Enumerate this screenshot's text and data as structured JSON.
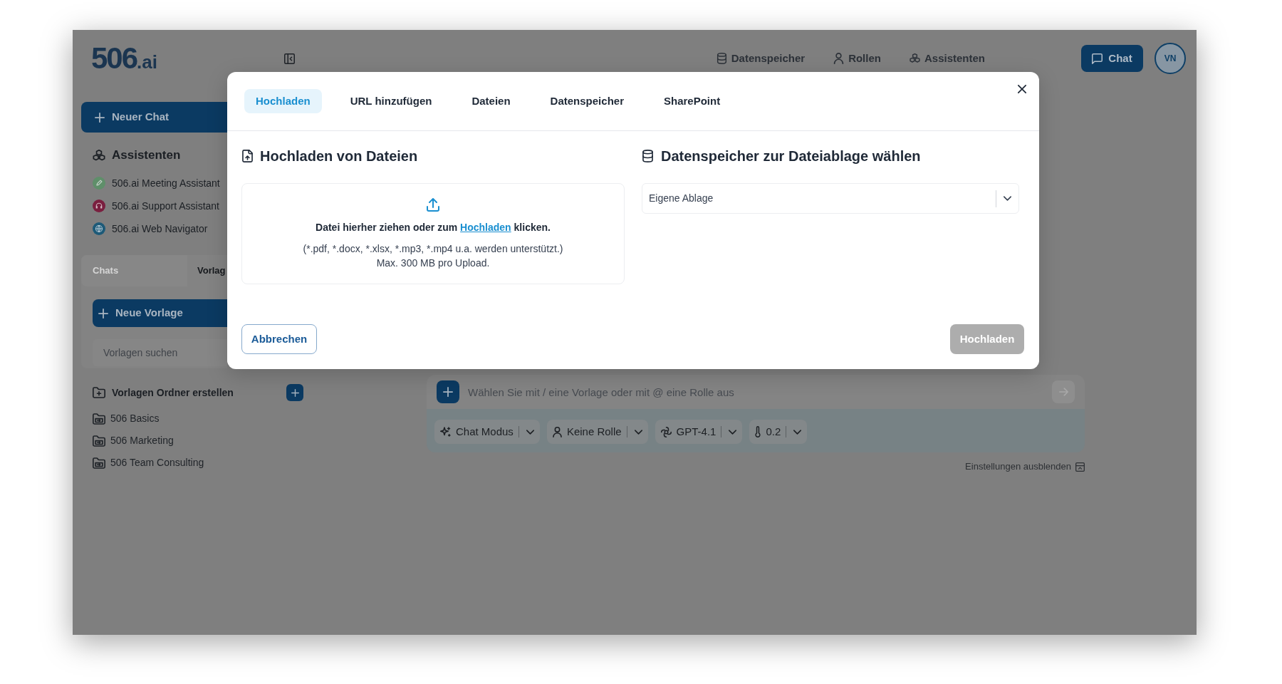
{
  "app": {
    "logo": {
      "mark": "506",
      "suffix": ".ai"
    },
    "nav": [
      {
        "label": "Datenspeicher"
      },
      {
        "label": "Rollen"
      },
      {
        "label": "Assistenten"
      }
    ],
    "chat_button": "Chat",
    "avatar": "VN"
  },
  "sidebar": {
    "new_chat_button": "Neuer Chat",
    "assistants_heading": "Assistenten",
    "assistants": [
      {
        "name": "506.ai Meeting Assistant",
        "color": "#5f8f6a"
      },
      {
        "name": "506.ai Support Assistant",
        "color": "#7a1f3f"
      },
      {
        "name": "506.ai Web Navigator",
        "color": "#1d5a78"
      }
    ],
    "tabs": [
      {
        "label": "Chats",
        "selected": false
      },
      {
        "label": "Vorlag",
        "selected": true
      }
    ],
    "new_template_button": "Neue Vorlage",
    "template_search": {
      "placeholder": "Vorlagen suchen"
    },
    "create_folder": "Vorlagen Ordner erstellen",
    "folders": [
      {
        "name": "506 Basics"
      },
      {
        "name": "506 Marketing"
      },
      {
        "name": "506 Team Consulting"
      }
    ]
  },
  "chat": {
    "input": {
      "placeholder": "Wählen Sie mit / eine Vorlage oder mit @ eine Rolle aus"
    },
    "settings": [
      {
        "label": "Chat Modus"
      },
      {
        "label": "Keine Rolle"
      },
      {
        "label": "GPT-4.1"
      },
      {
        "label": "0.2"
      }
    ],
    "hide_settings": "Einstellungen ausblenden"
  },
  "modal": {
    "tabs": [
      {
        "label": "Hochladen",
        "selected": true
      },
      {
        "label": "URL hinzufügen",
        "selected": false
      },
      {
        "label": "Dateien",
        "selected": false
      },
      {
        "label": "Datenspeicher",
        "selected": false
      },
      {
        "label": "SharePoint",
        "selected": false
      }
    ],
    "upload": {
      "title": "Hochladen von Dateien",
      "prompt_before": "Datei hierher ziehen oder zum ",
      "prompt_link": "Hochladen",
      "prompt_after": " klicken.",
      "formats": "(*.pdf, *.docx, *.xlsx, *.mp3, *.mp4 u.a. werden unterstützt.)",
      "limit": "Max. 300 MB pro Upload."
    },
    "storage": {
      "title": "Datenspeicher zur Dateiablage wählen",
      "value": "Eigene Ablage"
    },
    "cancel_button": "Abbrechen",
    "upload_button": {
      "label": "Hochladen",
      "disabled": true
    }
  }
}
